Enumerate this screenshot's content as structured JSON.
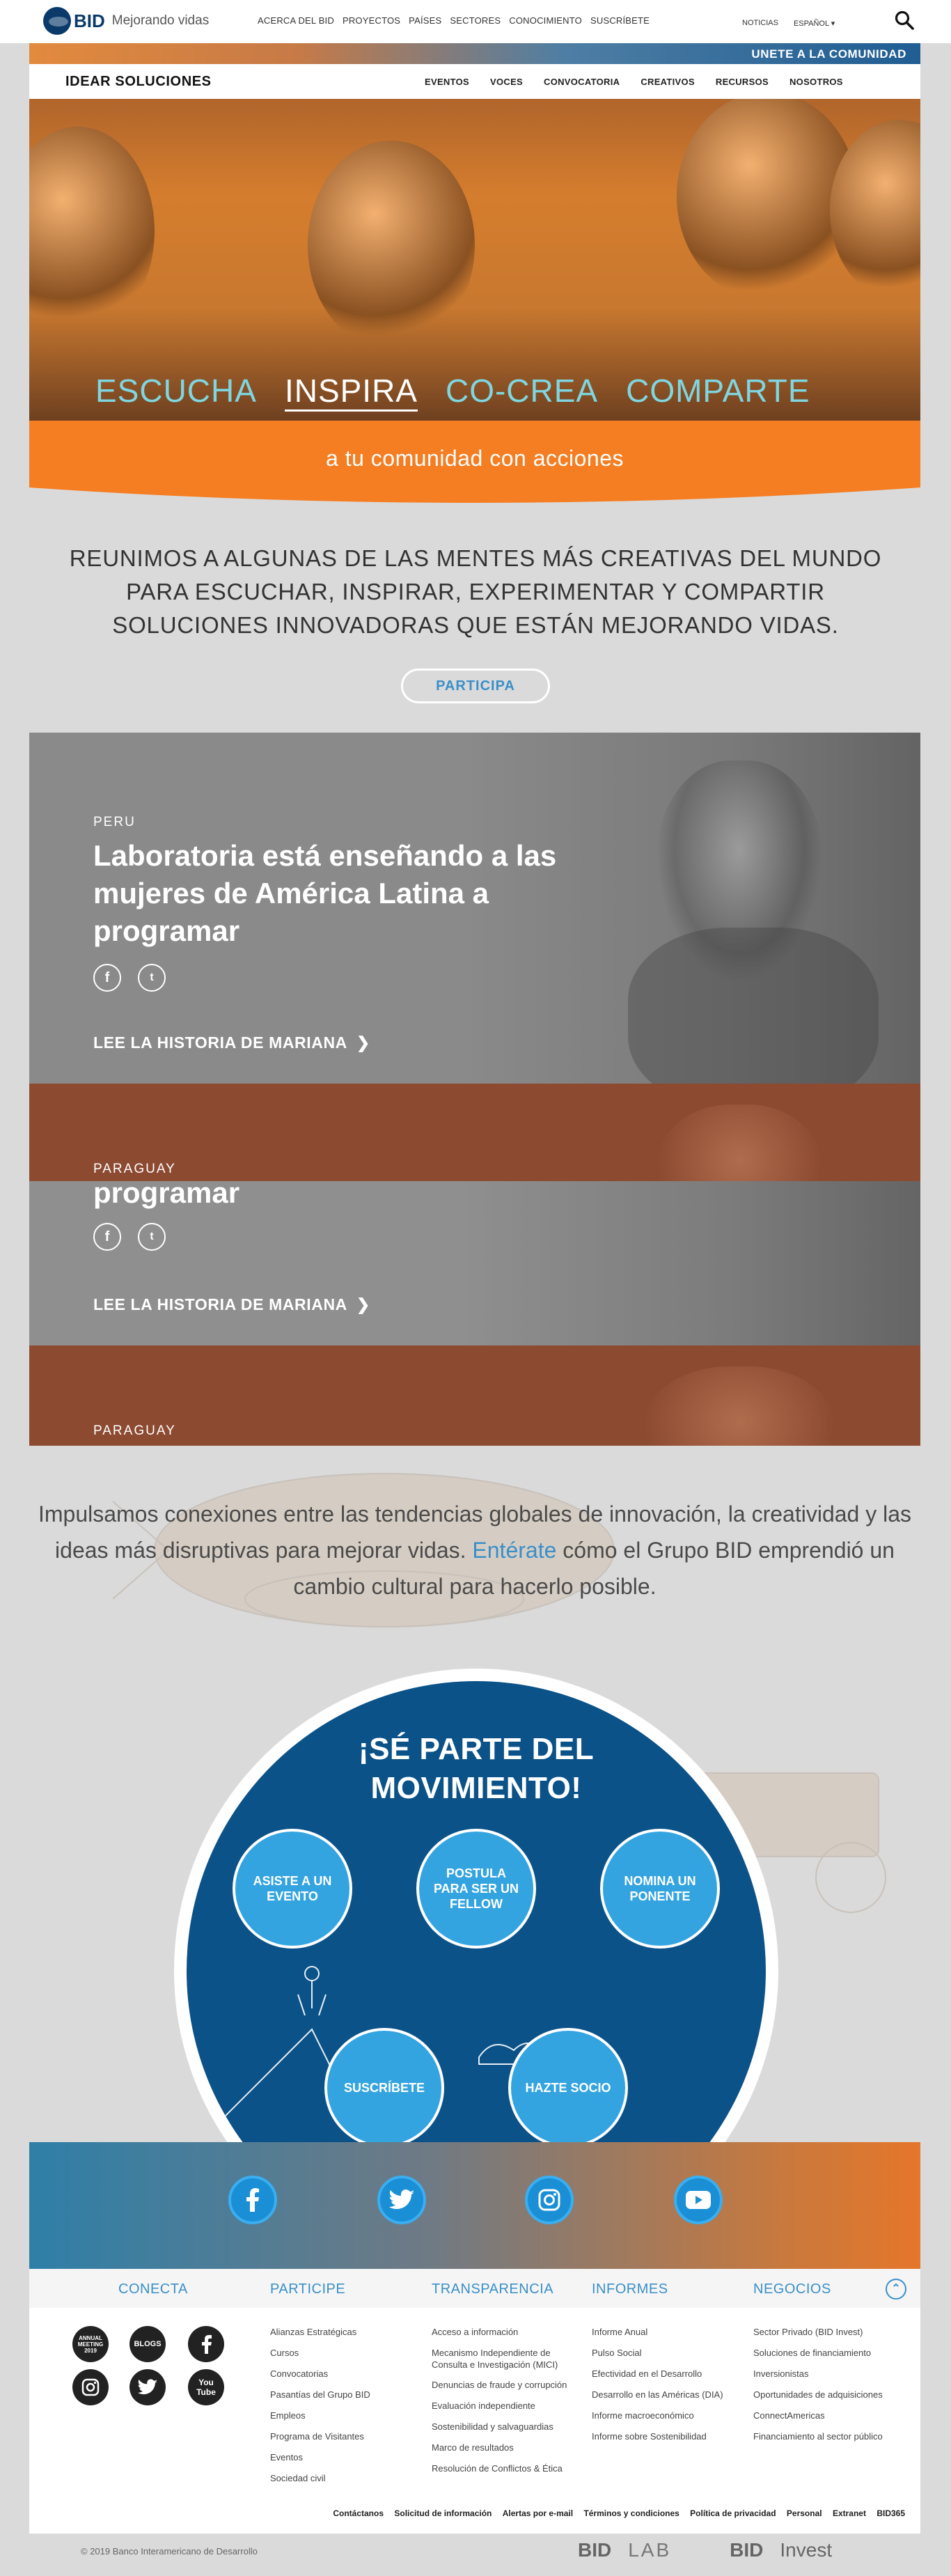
{
  "topbar": {
    "logo_text": "BID",
    "tagline": "Mejorando vidas",
    "nav": [
      "ACERCA DEL BID",
      "PROYECTOS",
      "PAÍSES",
      "SECTORES",
      "CONOCIMIENTO",
      "SUSCRÍBETE"
    ],
    "news": "NOTICIAS",
    "language": "ESPAÑOL ▾"
  },
  "site": {
    "join": "UNETE A LA COMUNIDAD",
    "brand": "IDEAR SOLUCIONES",
    "subnav": [
      "EVENTOS",
      "VOCES",
      "CONVOCATORIA",
      "CREATIVOS",
      "RECURSOS",
      "NOSOTROS"
    ]
  },
  "hero": {
    "words": [
      "ESCUCHA",
      "INSPIRA",
      "CO-CREA",
      "COMPARTE"
    ],
    "tagline": "a tu comunidad con acciones"
  },
  "intro": {
    "text": "REUNIMOS A ALGUNAS DE LAS MENTES MÁS CREATIVAS DEL MUNDO PARA ESCUCHAR, INSPIRAR, EXPERIMENTAR Y COMPARTIR SOLUCIONES INNOVADORAS QUE ESTÁN MEJORANDO VIDAS.",
    "button": "PARTICIPA"
  },
  "stories": {
    "country_1": "PERU",
    "title_1": "Laboratoria está enseñando a las mujeres de América Latina a programar",
    "link": "LEE LA HISTORIA DE MARIANA",
    "country_2": "PARAGUAY",
    "title_2_fragment": "programar",
    "link_2": "LEE LA HISTORIA DE MARIANA",
    "country_3": "PARAGUAY"
  },
  "conexiones": {
    "pre": "Impulsamos conexiones entre las tendencias globales de innovación, la creatividad y las ideas más disruptivas para mejorar vidas. ",
    "link": "Entérate",
    "post": " cómo el Grupo BID emprendió un cambio cultural para hacerlo posible."
  },
  "movimiento": {
    "title": "¡SÉ PARTE DEL MOVIMIENTO!",
    "options": [
      "ASISTE A UN EVENTO",
      "POSTULA PARA SER UN FELLOW",
      "NOMINA UN PONENTE",
      "SUSCRÍBETE",
      "HAZTE SOCIO"
    ]
  },
  "footer": {
    "columns": [
      {
        "title": "CONECTA",
        "items": []
      },
      {
        "title": "PARTICIPE",
        "items": [
          "Alianzas Estratégicas",
          "Cursos",
          "Convocatorias",
          "Pasantías del Grupo BID",
          "Empleos",
          "Programa de Visitantes",
          "Eventos",
          "Sociedad civil"
        ]
      },
      {
        "title": "TRANSPARENCIA",
        "items": [
          "Acceso a información",
          "Mecanismo Independiente de Consulta e Investigación (MICI)",
          "Denuncias de fraude y corrupción",
          "Evaluación independiente",
          "Sostenibilidad y salvaguardias",
          "Marco de resultados",
          "Resolución de Conflictos & Ética"
        ]
      },
      {
        "title": "INFORMES",
        "items": [
          "Informe Anual",
          "Pulso Social",
          "Efectividad en el Desarrollo",
          "Desarrollo en las Américas (DIA)",
          "Informe macroeconómico",
          "Informe sobre Sostenibilidad"
        ]
      },
      {
        "title": "NEGOCIOS",
        "items": [
          "Sector Privado (BID Invest)",
          "Soluciones de financiamiento",
          "Inversionistas",
          "Oportunidades de adquisiciones",
          "ConnectAmericas",
          "Financiamiento al sector público"
        ]
      }
    ],
    "conecta_icons": {
      "meeting": "ANNUAL MEETING 2019",
      "blogs": "BLOGS",
      "youtube": "You Tube"
    },
    "legal": [
      "Contáctanos",
      "Solicitud de información",
      "Alertas por e-mail",
      "Términos y condiciones",
      "Política de privacidad",
      "Personal",
      "Extranet",
      "BID365"
    ],
    "copyright": "© 2019 Banco Interamericano de Desarrollo",
    "logos": [
      "BID",
      "LAB",
      "BID",
      "Invest"
    ]
  }
}
